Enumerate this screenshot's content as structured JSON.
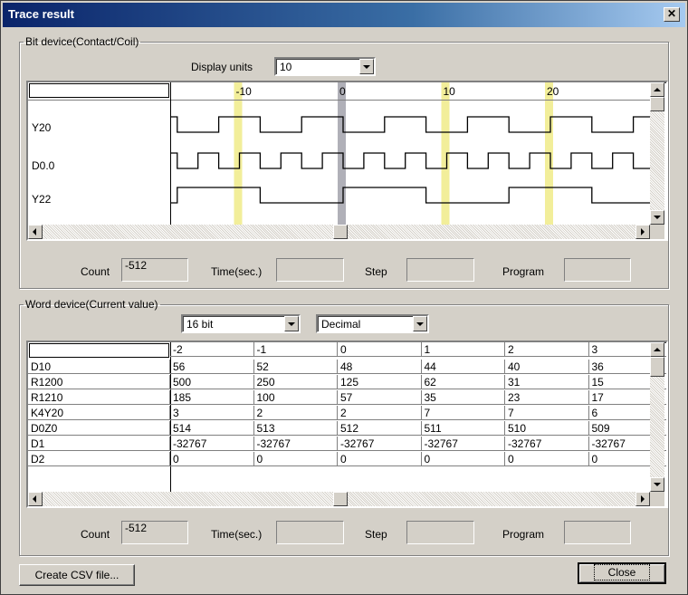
{
  "window": {
    "title": "Trace result",
    "close_glyph": "✕"
  },
  "bit": {
    "group_label": "Bit device(Contact/Coil)",
    "display_units_label": "Display units",
    "display_units_value": "10",
    "ruler_labels": [
      "-10",
      "0",
      "10",
      "20"
    ],
    "devices": [
      {
        "name": "Y20",
        "period_units": 8
      },
      {
        "name": "D0.0",
        "period_units": 4
      },
      {
        "name": "Y22",
        "period_units": 16
      }
    ],
    "marker_color_cursor": "#b0b0b8",
    "marker_color_tick": "#f2ee9a",
    "count_label": "Count",
    "count_value": "-512",
    "time_label": "Time(sec.)",
    "time_value": "",
    "step_label": "Step",
    "step_value": "",
    "program_label": "Program",
    "program_value": ""
  },
  "word": {
    "group_label": "Word device(Current value)",
    "bit_width_value": "16 bit",
    "format_value": "Decimal",
    "columns": [
      "-2",
      "-1",
      "0",
      "1",
      "2",
      "3"
    ],
    "rows": [
      {
        "name": "D10",
        "values": [
          "56",
          "52",
          "48",
          "44",
          "40",
          "36"
        ]
      },
      {
        "name": "R1200",
        "values": [
          "500",
          "250",
          "125",
          "62",
          "31",
          "15"
        ]
      },
      {
        "name": "R1210",
        "values": [
          "185",
          "100",
          "57",
          "35",
          "23",
          "17"
        ]
      },
      {
        "name": "K4Y20",
        "values": [
          "3",
          "2",
          "2",
          "7",
          "7",
          "6"
        ]
      },
      {
        "name": "D0Z0",
        "values": [
          "514",
          "513",
          "512",
          "511",
          "510",
          "509"
        ]
      },
      {
        "name": "D1",
        "values": [
          "-32767",
          "-32767",
          "-32767",
          "-32767",
          "-32767",
          "-32767"
        ]
      },
      {
        "name": "D2",
        "values": [
          "0",
          "0",
          "0",
          "0",
          "0",
          "0"
        ]
      }
    ],
    "count_label": "Count",
    "count_value": "-512",
    "time_label": "Time(sec.)",
    "time_value": "",
    "step_label": "Step",
    "step_value": "",
    "program_label": "Program",
    "program_value": ""
  },
  "buttons": {
    "csv_label": "Create CSV file...",
    "close_label": "Close"
  }
}
